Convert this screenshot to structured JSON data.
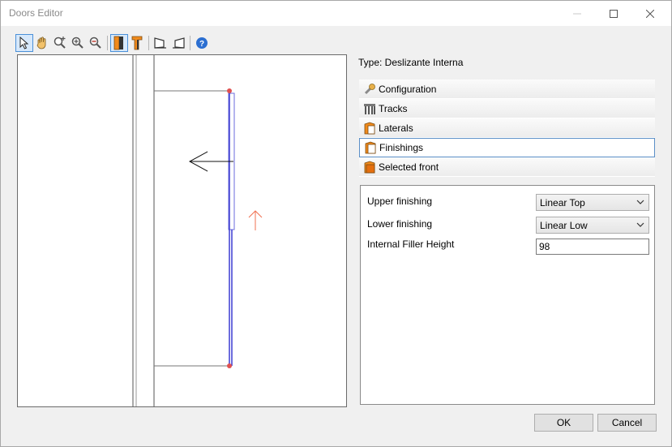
{
  "window": {
    "title": "Doors Editor"
  },
  "toolbar": {
    "icons": [
      "select-arrow-icon",
      "pan-hand-icon",
      "zoom-all-icon",
      "zoom-in-icon",
      "zoom-out-icon",
      "door-front-icon",
      "door-side-icon",
      "view-left-icon",
      "view-right-icon",
      "help-icon"
    ]
  },
  "panel": {
    "type_label": "Type: Deslizante Interna",
    "sections": [
      {
        "label": "Configuration",
        "icon": "wrench-icon"
      },
      {
        "label": "Tracks",
        "icon": "tracks-icon"
      },
      {
        "label": "Laterals",
        "icon": "laterals-icon"
      },
      {
        "label": "Finishings",
        "icon": "finishings-icon"
      },
      {
        "label": "Selected front",
        "icon": "selected-front-icon"
      }
    ],
    "selected_section": "Finishings"
  },
  "properties": {
    "upper_finishing": {
      "label": "Upper finishing",
      "value": "Linear Top"
    },
    "lower_finishing": {
      "label": "Lower finishing",
      "value": "Linear Low"
    },
    "internal_filler_height": {
      "label": "Internal Filler Height",
      "value": "98"
    }
  },
  "buttons": {
    "ok": "OK",
    "cancel": "Cancel"
  },
  "colors": {
    "accent": "#4a90d9",
    "door_line": "#3c3cd2",
    "marker": "#e05050",
    "arrow": "#f07050"
  }
}
